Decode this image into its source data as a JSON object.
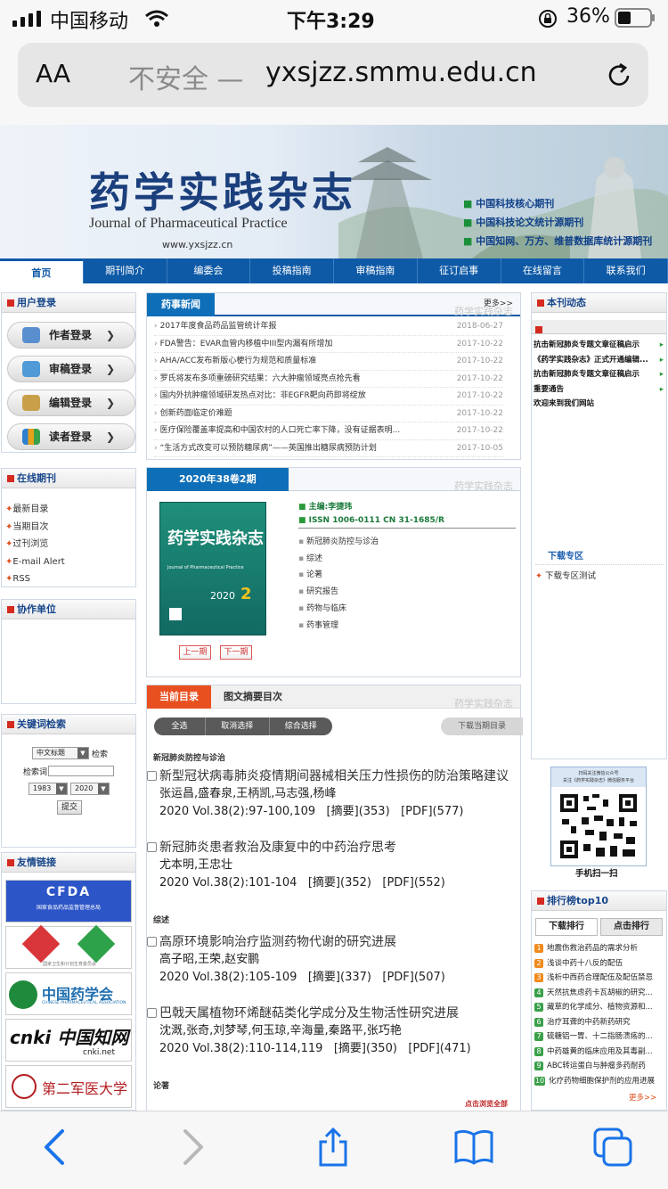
{
  "status_bar": {
    "carrier": "中国移动",
    "time": "下午3:29",
    "battery": "36%"
  },
  "url_bar": {
    "text_size": "AA",
    "security": "不安全 —",
    "domain": "yxsjzz.smmu.edu.cn"
  },
  "banner": {
    "title_cn": "药学实践杂志",
    "title_en": "Journal of Pharmaceutical Practice",
    "url": "www.yxsjzz.cn",
    "badges": [
      "中国科技核心期刊",
      "中国科技论文统计源期刊",
      "中国知网、万方、维普数据库统计源期刊"
    ]
  },
  "nav": [
    "首页",
    "期刊简介",
    "编委会",
    "投稿指南",
    "审稿指南",
    "征订启事",
    "在线留言",
    "联系我们"
  ],
  "login": {
    "title": "用户登录",
    "buttons": [
      "作者登录",
      "审稿登录",
      "编辑登录",
      "读者登录"
    ]
  },
  "online": {
    "title": "在线期刊",
    "links": [
      "最新目录",
      "当期目次",
      "过刊浏览",
      "E-mail Alert",
      "RSS"
    ]
  },
  "coop": {
    "title": "协作单位"
  },
  "keyword": {
    "title": "关键词检索",
    "field_select": "中文标题",
    "search_label": "检索",
    "term_label": "检索词",
    "year_from": "1983",
    "year_to": "2020",
    "submit": "提交"
  },
  "friends": {
    "title": "友情链接",
    "logos": [
      "CFDA",
      "国家卫生和计划生育委员会",
      "中国药学会",
      "cnki 中国知网",
      "第二军医大学"
    ],
    "cfda_sub": "国家食品药品监督管理总局",
    "cyxh_sub": "CHINESE PHARMACEUTICAL ASSOCIATION",
    "cnki_net": "cnki.net"
  },
  "news": {
    "tab": "药事新闻",
    "more": "更多>>",
    "watermark": "药学实践杂志",
    "items": [
      {
        "title": "2017年度食品药品监管统计年报",
        "date": "2018-06-27"
      },
      {
        "title": "FDA警告：EVAR血管内移植中III型内漏有所增加",
        "date": "2017-10-22"
      },
      {
        "title": "AHA/ACC发布新版心梗行为规范和质量标准",
        "date": "2017-10-22"
      },
      {
        "title": "罗氏将发布多项重磅研究结果：六大肿瘤领域亮点抢先看",
        "date": "2017-10-22"
      },
      {
        "title": "国内外抗肿瘤领域研发热点对比：非EGFR靶向药即将绽放",
        "date": "2017-10-22"
      },
      {
        "title": "创新药面临定价难题",
        "date": "2017-10-22"
      },
      {
        "title": "医疗保险覆盖率提高和中国农村的人口死亡率下降，没有证据表明...",
        "date": "2017-10-22"
      },
      {
        "title": "“生活方式改变可以预防糖尿病”——英国推出糖尿病预防计划",
        "date": "2017-10-05"
      }
    ]
  },
  "issue": {
    "tab": "2020年38卷2期",
    "editor": "主编:李捷玮",
    "issn": "ISSN 1006-0111 CN 31-1685/R",
    "cover_title": "药学实践杂志",
    "cover_en": "Journal of Pharmaceutical Practice",
    "cover_issue": "2020",
    "cover_num": "2",
    "categories": [
      "新冠肺炎防控与诊治",
      "综述",
      "论著",
      "研究报告",
      "药物与临床",
      "药事管理"
    ],
    "prev": "上一期",
    "next": "下一期"
  },
  "toc": {
    "tab_current": "当前目录",
    "tab_abstract": "图文摘要目次",
    "btn_all": "全选",
    "btn_cancel": "取消选择",
    "btn_combo": "综合选择",
    "btn_download": "下载当期目录",
    "sections": [
      {
        "name": "新冠肺炎防控与诊治"
      },
      {
        "name": "综述"
      },
      {
        "name": "论著"
      }
    ],
    "articles": [
      {
        "title": "新型冠状病毒肺炎疫情期间器械相关压力性损伤的防治策略建议",
        "authors": "张运昌,盛春泉,王柄凯,马志强,杨峰",
        "meta": "2020 Vol.38(2):97-100,109",
        "abstract": "[摘要](353)",
        "pdf": "[PDF](577)"
      },
      {
        "title": "新冠肺炎患者救治及康复中的中药治疗思考",
        "authors": "尤本明,王忠壮",
        "meta": "2020 Vol.38(2):101-104",
        "abstract": "[摘要](352)",
        "pdf": "[PDF](552)"
      },
      {
        "title": "高原环境影响治疗监测药物代谢的研究进展",
        "authors": "高子昭,王荣,赵安鹏",
        "meta": "2020 Vol.38(2):105-109",
        "abstract": "[摘要](337)",
        "pdf": "[PDF](507)"
      },
      {
        "title": "巴戟天属植物环烯醚萜类化学成分及生物活性研究进展",
        "authors": "沈溉,张奇,刘梦琴,何玉琼,辛海量,秦路平,张巧艳",
        "meta": "2020 Vol.38(2):110-114,119",
        "abstract": "[摘要](350)",
        "pdf": "[PDF](471)"
      }
    ],
    "browse_all": "点击浏览全部"
  },
  "dynamics": {
    "title": "本刊动态",
    "items": [
      "抗击新冠肺炎专题文章征稿启示",
      "《药学实践杂志》正式开通编辑...",
      "抗击新冠肺炎专题文章征稿启示",
      "重要通告",
      "欢迎来到我们网站"
    ],
    "download_zone": "下载专区",
    "download_item": "下载专区测试"
  },
  "qr": {
    "header_line1": "扫码关注微信公众号",
    "header_line2": "关注《药学实践杂志》微信服务平台",
    "caption": "手机扫一扫"
  },
  "ranking": {
    "title": "排行榜top10",
    "tab_download": "下载排行",
    "tab_click": "点击排行",
    "items": [
      "地震伤救治药品的需求分析",
      "浅谈中药十八反的配伍",
      "浅析中西药合理配伍及配伍禁忌",
      "天然抗焦虑药卡瓦胡椒的研究...",
      "藏草的化学成分、植物资源和...",
      "治疗耳聋的中药新药研究",
      "硫糖铝一胃、十二指肠溃疡的...",
      "中药雄黄的临床应用及其毒副...",
      "ABC转运蛋白与肿瘤多药耐药",
      "化疗药物细胞保护剂的应用进展"
    ],
    "more": "更多>>"
  },
  "colors": {
    "nav_blue": "#0e5aa7",
    "accent_red": "#d52a1f",
    "tab_orange": "#e8501f",
    "link_blue": "#17468a"
  }
}
